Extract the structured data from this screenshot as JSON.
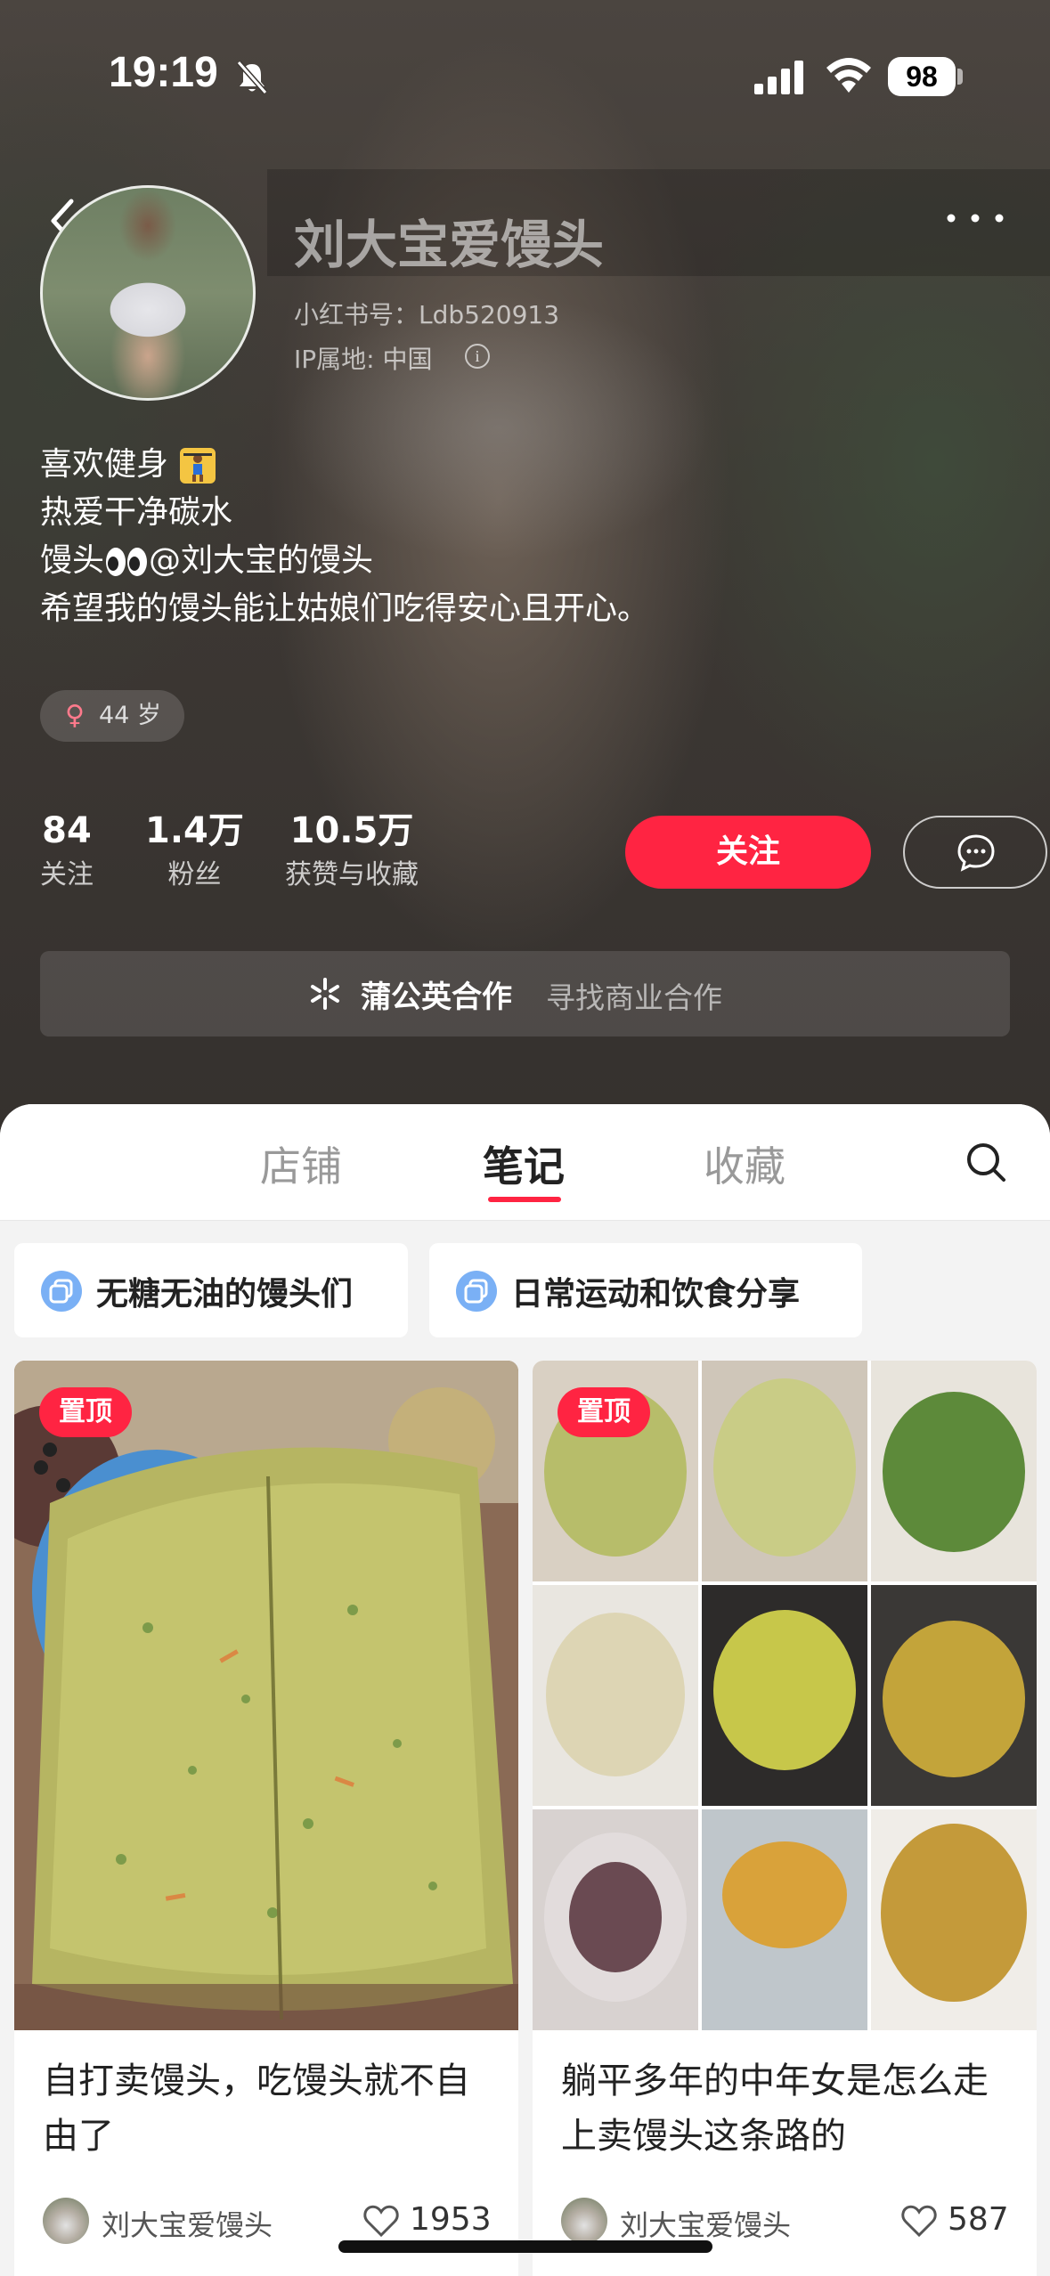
{
  "status": {
    "time": "19:19",
    "battery": "98"
  },
  "profile": {
    "name": "刘大宝爱馒头",
    "id_text": "小红书号：Ldb520913",
    "ip_text": "IP属地: 中国",
    "bio": [
      "喜欢健身",
      "热爱干净碳水",
      "馒头",
      "@刘大宝的馒头",
      "希望我的馒头能让姑娘们吃得安心且开心。"
    ],
    "age": "44 岁",
    "stats": [
      {
        "num": "84",
        "label": "关注"
      },
      {
        "num": "1.4万",
        "label": "粉丝"
      },
      {
        "num": "10.5万",
        "label": "获赞与收藏"
      }
    ],
    "follow_label": "关注",
    "biz_title": "蒲公英合作",
    "biz_sub": "寻找商业合作"
  },
  "tabs": [
    "店铺",
    "笔记",
    "收藏"
  ],
  "active_tab": "笔记",
  "collections": [
    "无糖无油的馒头们",
    "日常运动和饮食分享"
  ],
  "notes": [
    {
      "pin": "置顶",
      "title": "自打卖馒头，吃馒头就不自由了",
      "author": "刘大宝爱馒头",
      "likes": "1953"
    },
    {
      "pin": "置顶",
      "title": "躺平多年的中年女是怎么走上卖馒头这条路的",
      "author": "刘大宝爱馒头",
      "likes": "587"
    }
  ],
  "colors": {
    "accent": "#ff2442",
    "tab_underline": "#ff2442"
  }
}
